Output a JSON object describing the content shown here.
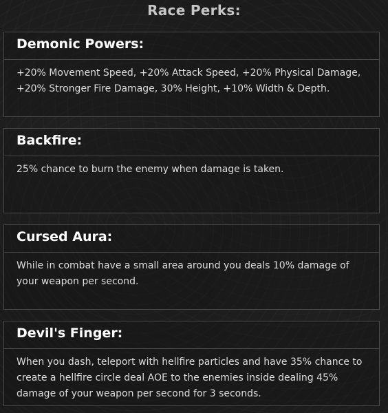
{
  "window": {
    "title": "Race Perks:"
  },
  "perks": [
    {
      "name": "Demonic Powers:",
      "description": "+20% Movement Speed, +20% Attack Speed, +20% Physical Damage, +20% Stronger Fire Damage, 30% Height, +10% Width & Depth."
    },
    {
      "name": "Backfire:",
      "description": "25% chance to burn the enemy when damage is taken."
    },
    {
      "name": "Cursed Aura:",
      "description": "While in combat have a small area around you deals 10% damage of your weapon per second."
    },
    {
      "name": "Devil's Finger:",
      "description": "When you dash, teleport with hellfire particles and have 35% chance to create a hellfire circle deal AOE to the enemies inside dealing 45% damage of your weapon per second for 3 seconds."
    }
  ]
}
